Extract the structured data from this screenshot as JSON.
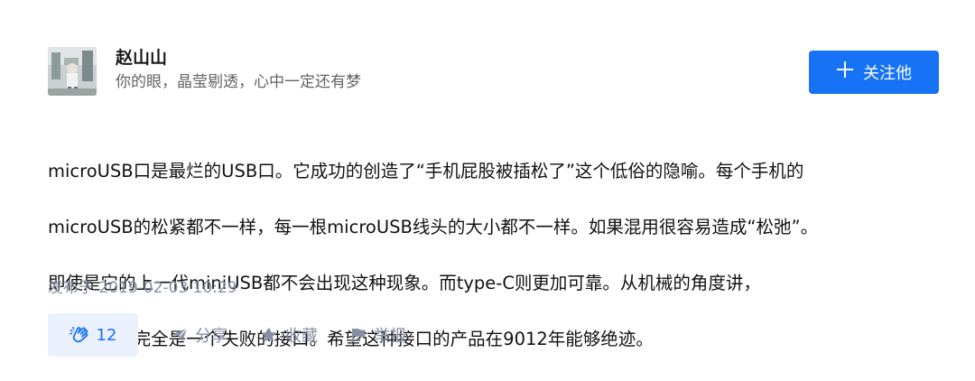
{
  "author": {
    "name": "赵山山",
    "bio": "你的眼，晶莹剔透，心中一定还有梦",
    "avatar_icon": "avatar-image"
  },
  "follow_button": {
    "icon": "plus-icon",
    "label": "关注他"
  },
  "content": {
    "lines": [
      "microUSB口是最烂的USB口。它成功的创造了“手机屁股被插松了”这个低俗的隐喻。每个手机的",
      "microUSB的松紧都不一样，每一根microUSB线头的大小都不一样。如果混用很容易造成“松弛”。",
      "即使是它的上一代miniUSB都不会出现这种现象。而type-C则更加可靠。从机械的角度讲，",
      "microUSB完全是一个失败的接口。希望这种接口的产品在9012年能够绝迹。"
    ]
  },
  "timestamp": "发布于 2019-02-03 10:29",
  "actions": {
    "clap_count": "12",
    "share_label": "分享",
    "favorite_label": "收藏",
    "report_label": "举报"
  },
  "colors": {
    "accent": "#1772f6",
    "accent_bg": "#eaf1fd",
    "muted": "#8590a6"
  }
}
